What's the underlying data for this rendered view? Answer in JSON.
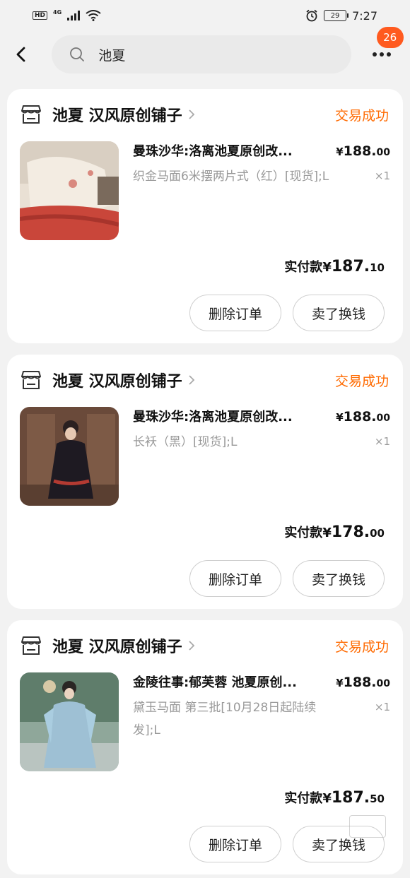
{
  "statusbar": {
    "hd": "HD",
    "network": "4G",
    "battery": "29",
    "time": "7:27"
  },
  "header": {
    "search_text": "池夏",
    "msg_count": "26"
  },
  "orders": [
    {
      "shop": "池夏 汉风原创铺子",
      "status": "交易成功",
      "title": "曼珠沙华:洛离池夏原创改...",
      "price_symbol": "¥",
      "price_int": "188.",
      "price_dec": "00",
      "spec": "织金马面6米摆两片式（红）[现货];L",
      "qty": "×1",
      "paid_label": "实付款",
      "paid_symbol": "¥",
      "paid_int": "187.",
      "paid_dec": "10",
      "btn_delete": "删除订单",
      "btn_sell": "卖了换钱"
    },
    {
      "shop": "池夏 汉风原创铺子",
      "status": "交易成功",
      "title": "曼珠沙华:洛离池夏原创改...",
      "price_symbol": "¥",
      "price_int": "188.",
      "price_dec": "00",
      "spec": "长袄（黑）[现货];L",
      "qty": "×1",
      "paid_label": "实付款",
      "paid_symbol": "¥",
      "paid_int": "178.",
      "paid_dec": "00",
      "btn_delete": "删除订单",
      "btn_sell": "卖了换钱"
    },
    {
      "shop": "池夏 汉风原创铺子",
      "status": "交易成功",
      "title": "金陵往事:郁芙蓉 池夏原创...",
      "price_symbol": "¥",
      "price_int": "188.",
      "price_dec": "00",
      "spec": "黛玉马面 第三批[10月28日起陆续发];L",
      "qty": "×1",
      "paid_label": "实付款",
      "paid_symbol": "¥",
      "paid_int": "187.",
      "paid_dec": "50",
      "btn_delete": "删除订单",
      "btn_sell": "卖了换钱"
    }
  ],
  "icons": {
    "back": "chevron-left-icon",
    "search": "search-icon",
    "more": "more-dots-icon",
    "shop": "store-icon",
    "chevron": "chevron-right-icon"
  },
  "colors": {
    "accent": "#ff6a00",
    "badge": "#ff5a1f",
    "bg": "#f2f2f2"
  }
}
